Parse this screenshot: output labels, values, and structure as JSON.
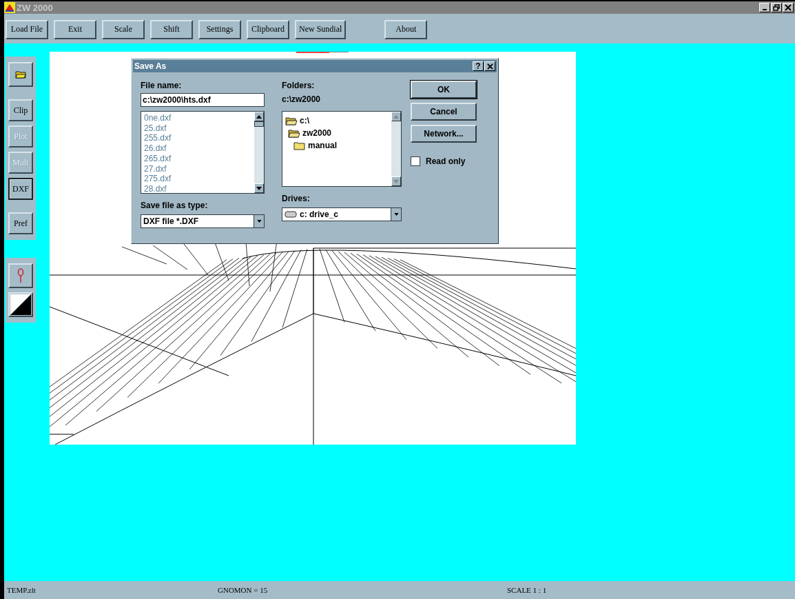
{
  "window": {
    "title": "ZW 2000"
  },
  "toolbar": [
    {
      "label": "Load File"
    },
    {
      "label": "Exit"
    },
    {
      "label": "Scale"
    },
    {
      "label": "Shift"
    },
    {
      "label": "Settings"
    },
    {
      "label": "Clipboard"
    },
    {
      "label": "New Sundial"
    },
    {
      "label": "About"
    }
  ],
  "side_buttons": [
    {
      "label": "Clip",
      "disabled": false,
      "selected": false
    },
    {
      "label": "Plot",
      "disabled": true,
      "selected": false
    },
    {
      "label": "Mult",
      "disabled": true,
      "selected": false
    },
    {
      "label": "DXF",
      "disabled": false,
      "selected": true
    },
    {
      "label": "Pref",
      "disabled": false,
      "selected": false
    }
  ],
  "dialog": {
    "title": "Save As",
    "help": "?",
    "file_name": {
      "label": "File name:",
      "value": "c:\\zw2000\\hts.dxf"
    },
    "files": [
      "0ne.dxf",
      "25.dxf",
      "255.dxf",
      "26.dxf",
      "265.dxf",
      "27.dxf",
      "275.dxf",
      "28.dxf"
    ],
    "file_type": {
      "label": "Save file as type:",
      "value": "DXF file *.DXF"
    },
    "folders": {
      "label": "Folders:",
      "path": "c:\\zw2000",
      "tree": [
        {
          "name": "c:\\",
          "expanded": true,
          "children": [
            {
              "name": "zw2000",
              "expanded": true,
              "children": [
                {
                  "name": "manual",
                  "expanded": false
                }
              ]
            }
          ]
        }
      ]
    },
    "drives": {
      "label": "Drives:",
      "value": "c: drive_c"
    },
    "buttons": [
      {
        "label": "OK",
        "default": true
      },
      {
        "label": "Cancel",
        "default": false
      },
      {
        "label": "Network...",
        "default": false
      }
    ],
    "read_only": {
      "label": "Read only",
      "checked": false
    }
  },
  "status_bar": [
    "TEMP.zlt",
    "GNOMON = 15",
    "SCALE 1 : 1"
  ]
}
